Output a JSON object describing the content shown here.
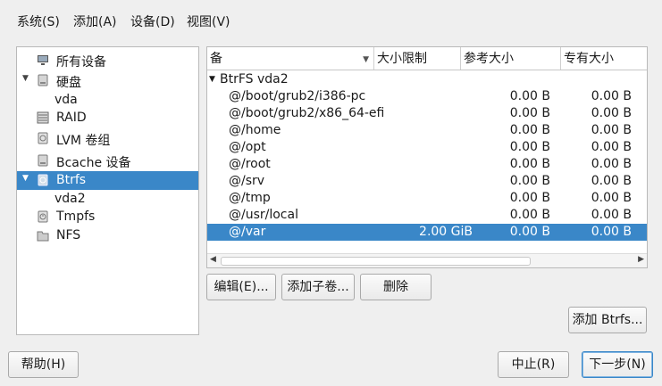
{
  "menu": [
    {
      "label": "系统(S)"
    },
    {
      "label": "添加(A)"
    },
    {
      "label": "设备(D)"
    },
    {
      "label": "视图(V)"
    }
  ],
  "tree": {
    "items": [
      {
        "label": "所有设备",
        "icon": "monitor-icon"
      },
      {
        "label": "硬盘",
        "icon": "disk-icon",
        "expanded": true
      },
      {
        "label": "vda"
      },
      {
        "label": "RAID",
        "icon": "raid-icon"
      },
      {
        "label": "LVM 卷组",
        "icon": "lvm-icon"
      },
      {
        "label": "Bcache 设备",
        "icon": "bcache-icon"
      },
      {
        "label": "Btrfs",
        "icon": "btrfs-icon",
        "expanded": true,
        "selected": true
      },
      {
        "label": "vda2"
      },
      {
        "label": "Tmpfs",
        "icon": "tmpfs-icon"
      },
      {
        "label": "NFS",
        "icon": "nfs-icon"
      }
    ]
  },
  "table": {
    "columns": [
      "备",
      "大小限制",
      "参考大小",
      "专有大小"
    ],
    "group_label": "BtrFS vda2",
    "rows": [
      {
        "name": "@/boot/grub2/i386-pc",
        "limit": "",
        "ref": "0.00 B",
        "excl": "0.00 B"
      },
      {
        "name": "@/boot/grub2/x86_64-efi",
        "limit": "",
        "ref": "0.00 B",
        "excl": "0.00 B"
      },
      {
        "name": "@/home",
        "limit": "",
        "ref": "0.00 B",
        "excl": "0.00 B"
      },
      {
        "name": "@/opt",
        "limit": "",
        "ref": "0.00 B",
        "excl": "0.00 B"
      },
      {
        "name": "@/root",
        "limit": "",
        "ref": "0.00 B",
        "excl": "0.00 B"
      },
      {
        "name": "@/srv",
        "limit": "",
        "ref": "0.00 B",
        "excl": "0.00 B"
      },
      {
        "name": "@/tmp",
        "limit": "",
        "ref": "0.00 B",
        "excl": "0.00 B"
      },
      {
        "name": "@/usr/local",
        "limit": "",
        "ref": "0.00 B",
        "excl": "0.00 B"
      },
      {
        "name": "@/var",
        "limit": "2.00 GiB",
        "ref": "0.00 B",
        "excl": "0.00 B",
        "selected": true
      }
    ]
  },
  "buttons": {
    "edit": "编辑(E)...",
    "add_subvolume": "添加子卷...",
    "delete": "删除",
    "add_btrfs": "添加 Btrfs...",
    "help": "帮助(H)",
    "abort": "中止(R)",
    "next": "下一步(N)"
  },
  "colors": {
    "selection": "#3a87c8",
    "background": "#efefef"
  }
}
